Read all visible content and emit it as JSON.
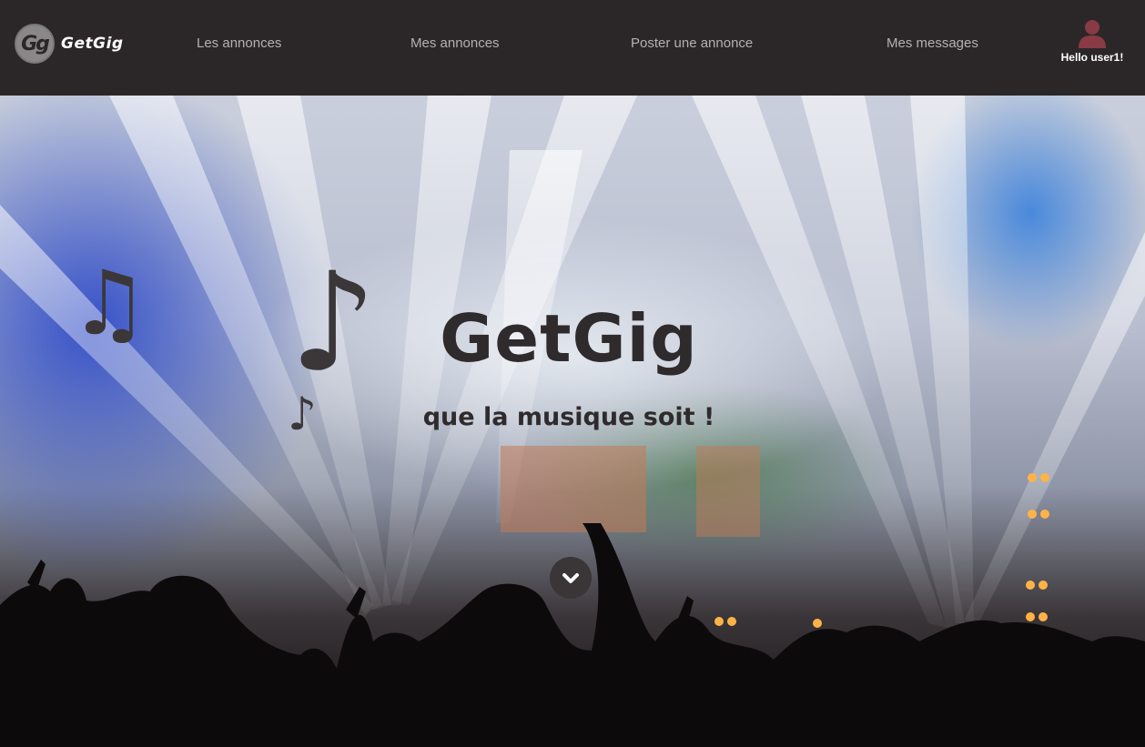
{
  "brand": {
    "logo_letters": "Gg",
    "name": "GetGig"
  },
  "nav": {
    "items": [
      {
        "label": "Les annonces"
      },
      {
        "label": "Mes annonces"
      },
      {
        "label": "Poster une annonce"
      },
      {
        "label": "Mes messages"
      }
    ]
  },
  "user": {
    "greeting": "Hello user1!",
    "icon": "user-icon",
    "icon_color": "#8a3a44"
  },
  "hero": {
    "title": "GetGig",
    "subtitle": "que la musique soit !",
    "notes": [
      "♫",
      "♪",
      "♪"
    ],
    "scroll_icon": "chevron-down-icon"
  },
  "colors": {
    "navbar_bg": "#2b2728",
    "nav_text": "#b4b1b2",
    "hero_text": "#2f2b2c"
  }
}
